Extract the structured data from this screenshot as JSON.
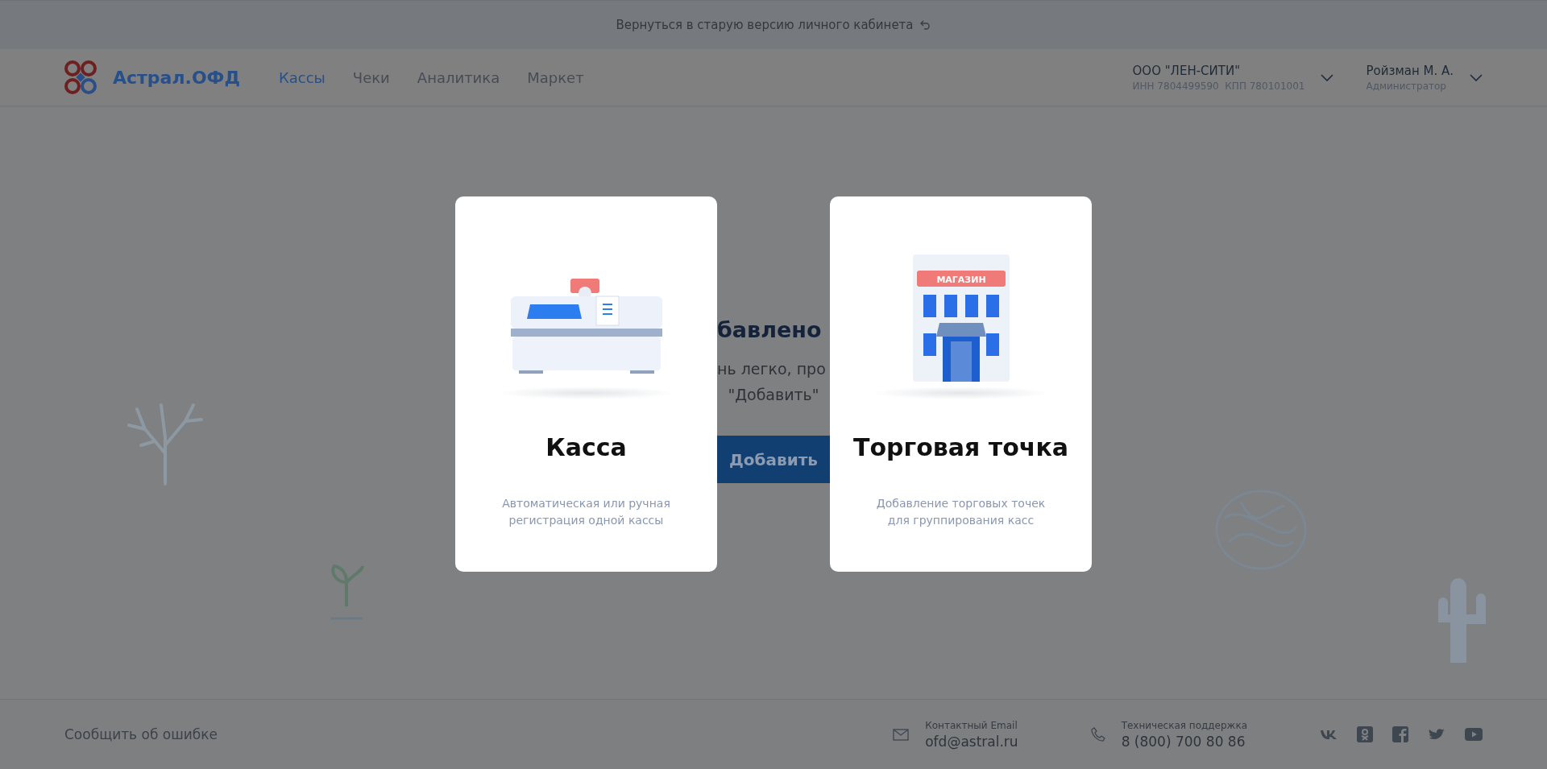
{
  "banner": {
    "text": "Вернуться в старую версию личного кабинета"
  },
  "header": {
    "logo": "Астрал.ОФД",
    "nav": [
      {
        "label": "Кассы",
        "selected": true
      },
      {
        "label": "Чеки",
        "selected": false
      },
      {
        "label": "Аналитика",
        "selected": false
      },
      {
        "label": "Маркет",
        "selected": false
      }
    ],
    "organization": {
      "name": "ООО \"ЛЕН-СИТИ\"",
      "details": "ИНН 7804499590  КПП 780101001"
    },
    "user": {
      "name": "Ройзман М. А.",
      "role": "Администратор"
    }
  },
  "background": {
    "heading": "бавлено",
    "lines": [
      "нь легко, про",
      "\"Добавить\""
    ],
    "button": "Добавить"
  },
  "cards": [
    {
      "kind": "register",
      "title": "Касса",
      "description_lines": [
        "Автоматическая или ручная",
        "регистрация одной кассы"
      ]
    },
    {
      "kind": "store",
      "sign": "МАГАЗИН",
      "title": "Торговая точка",
      "description_lines": [
        "Добавление торговых точек",
        "для группирования касс"
      ]
    }
  ],
  "footer": {
    "report_link": "Сообщить об ошибке",
    "contacts": [
      {
        "kind": "email",
        "label": "Контактный Email",
        "value": "ofd@astral.ru"
      },
      {
        "kind": "phone",
        "label": "Техническая поддержка",
        "value": "8 (800) 700 80 86"
      }
    ]
  }
}
